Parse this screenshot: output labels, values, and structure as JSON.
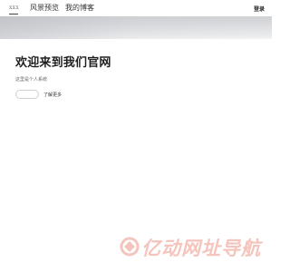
{
  "nav": {
    "logo": "xxx",
    "items": [
      {
        "label": "风景预览"
      },
      {
        "label": "我的博客"
      }
    ],
    "login": "登录"
  },
  "hero": {
    "title": "欢迎来到我们官网",
    "subtitle": "这里是个人系统",
    "more_label": "了解更多"
  },
  "watermark": {
    "text": "亿动网址导航"
  },
  "colors": {
    "watermark": "#f5c4bd",
    "banner": "#d6d7da"
  }
}
